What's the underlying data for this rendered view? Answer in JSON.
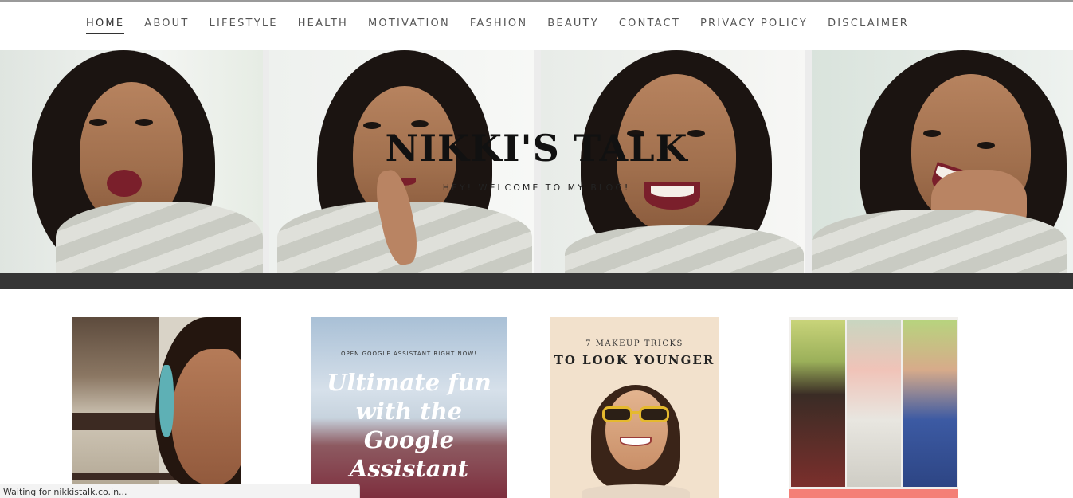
{
  "nav": {
    "items": [
      {
        "label": "HOME",
        "active": true
      },
      {
        "label": "ABOUT"
      },
      {
        "label": "LIFESTYLE"
      },
      {
        "label": "HEALTH"
      },
      {
        "label": "MOTIVATION"
      },
      {
        "label": "FASHION"
      },
      {
        "label": "BEAUTY"
      },
      {
        "label": "CONTACT"
      },
      {
        "label": "PRIVACY POLICY"
      },
      {
        "label": "DISCLAIMER"
      }
    ]
  },
  "hero": {
    "title": "NIKKI'S TALK",
    "subtitle": "HEY! WELCOME TO MY BLOG!"
  },
  "posts": [
    {
      "image": "woman-smiling-photo"
    },
    {
      "image": "flower-field-graphic",
      "top_text": "OPEN GOOGLE ASSISTANT RIGHT NOW!",
      "title": "Ultimate fun with the Google Assistant"
    },
    {
      "image": "woman-sunglasses-graphic",
      "top_text": "7 MAKEUP TRICKS",
      "title": "TO LOOK YOUNGER"
    },
    {
      "image": "three-photo-collage"
    }
  ],
  "status_bar": {
    "text": "Waiting for nikkistalk.co.in..."
  },
  "colors": {
    "hero_band": "#353535",
    "nav_text": "#555555",
    "collage_band": "#f47f76"
  }
}
